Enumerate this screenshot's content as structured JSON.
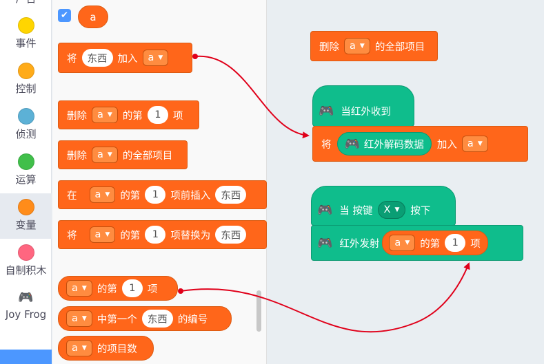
{
  "categories": [
    {
      "label": "广告",
      "color": ""
    },
    {
      "label": "事件",
      "color": "#ffd500"
    },
    {
      "label": "控制",
      "color": "#ffab19"
    },
    {
      "label": "侦测",
      "color": "#5cb1d6"
    },
    {
      "label": "运算",
      "color": "#40bf4a"
    },
    {
      "label": "变量",
      "color": "#ff8c1a"
    },
    {
      "label": "自制积木",
      "color": "#ff6680"
    },
    {
      "label": "Joy Frog",
      "icon": "gamepad-icon"
    }
  ],
  "palette": {
    "checkbox_mark": "✔",
    "variable_name": "a",
    "add_block": {
      "word1": "将",
      "item": "东西",
      "word2": "加入",
      "list": "a"
    },
    "delete_nth": {
      "word1": "删除",
      "list": "a",
      "word2": "的第",
      "index": "1",
      "word3": "项"
    },
    "delete_all": {
      "word1": "删除",
      "list": "a",
      "word2": "的全部项目"
    },
    "insert_at": {
      "word1": "在",
      "list": "a",
      "word2": "的第",
      "index": "1",
      "word3": "项前插入",
      "item": "东西"
    },
    "replace_at": {
      "word1": "将",
      "list": "a",
      "word2": "的第",
      "index": "1",
      "word3": "项替换为",
      "item": "东西"
    },
    "item_of": {
      "list": "a",
      "word1": "的第",
      "index": "1",
      "word2": "项"
    },
    "index_of": {
      "list": "a",
      "word1": "中第一个",
      "item": "东西",
      "word2": "的编号"
    },
    "length_of": {
      "list": "a",
      "word1": "的项目数"
    }
  },
  "workspace": {
    "delete_all": {
      "word1": "删除",
      "list": "a",
      "word2": "的全部项目"
    },
    "ir_receive_hat": {
      "label": "当红外收到"
    },
    "ir_add": {
      "word1": "将",
      "reporter": "红外解码数据",
      "word2": "加入",
      "list": "a"
    },
    "key_hat": {
      "word1": "当 按键",
      "key": "X",
      "word2": "按下"
    },
    "ir_send": {
      "word1": "红外发射",
      "list": "a",
      "word2": "的第",
      "index": "1",
      "word3": "项"
    }
  },
  "colors": {
    "data_orange": "#ff661a",
    "extension_green": "#0fbd8c",
    "arrow_red": "#e0001a",
    "selected_category_bg": "#e6eaf0"
  }
}
